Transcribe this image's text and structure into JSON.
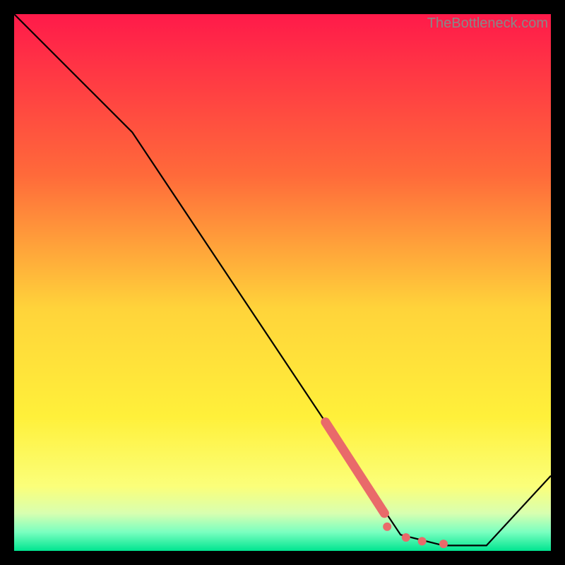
{
  "attribution": "TheBottleneck.com",
  "chart_data": {
    "type": "line",
    "title": "",
    "xlabel": "",
    "ylabel": "",
    "xlim": [
      0,
      100
    ],
    "ylim": [
      0,
      100
    ],
    "series": [
      {
        "name": "curve",
        "x": [
          0,
          22,
          68,
          72,
          80,
          88,
          100
        ],
        "y": [
          100,
          78,
          9,
          3,
          1,
          1,
          14
        ]
      }
    ],
    "highlight_segment": {
      "x": [
        58,
        69
      ],
      "y": [
        24,
        7
      ]
    },
    "highlight_dots": [
      {
        "x": 69.5,
        "y": 4.5
      },
      {
        "x": 73,
        "y": 2.5
      },
      {
        "x": 76,
        "y": 1.8
      },
      {
        "x": 80,
        "y": 1.3
      }
    ],
    "gradient_stops": [
      {
        "offset": 0,
        "color": "#ff1a4a"
      },
      {
        "offset": 0.3,
        "color": "#ff6a3a"
      },
      {
        "offset": 0.55,
        "color": "#ffd43a"
      },
      {
        "offset": 0.75,
        "color": "#fff03a"
      },
      {
        "offset": 0.88,
        "color": "#fbff7a"
      },
      {
        "offset": 0.93,
        "color": "#d8ffb0"
      },
      {
        "offset": 0.965,
        "color": "#7affc0"
      },
      {
        "offset": 1.0,
        "color": "#00e590"
      }
    ]
  }
}
